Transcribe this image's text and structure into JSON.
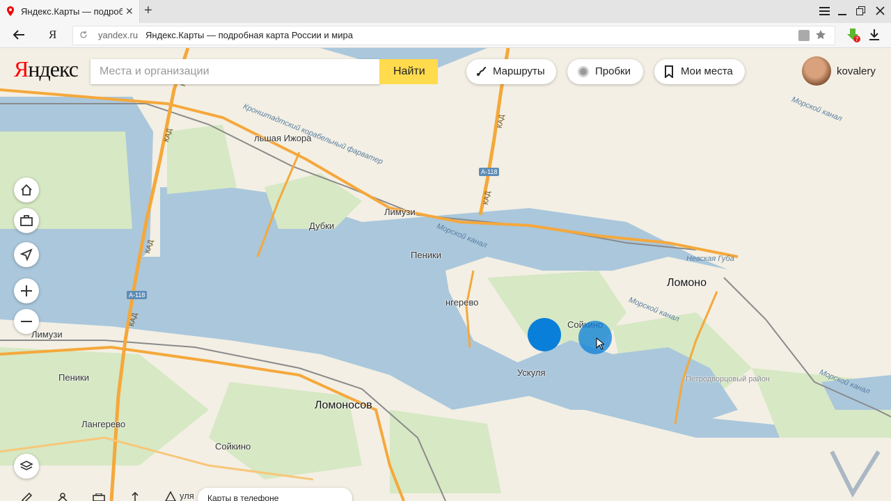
{
  "browser": {
    "tab_title": "Яндекс.Карты — подробная карта России и мира",
    "tab_close": "✕",
    "new_tab": "+",
    "yandex_button": "Я",
    "url_host": "yandex.ru",
    "url_page_title": "Яндекс.Карты — подробная карта России и мира"
  },
  "header": {
    "logo_first": "Я",
    "logo_rest": "ндекс",
    "search_placeholder": "Места и организации",
    "search_button": "Найти",
    "routes_label": "Маршруты",
    "traffic_label": "Пробки",
    "my_places_label": "Мои места",
    "username": "kovalery"
  },
  "map_labels": {
    "kronstadt_channel": "Кронштадтский корабельный фарватер",
    "bolshaya_izhora": "льшая Ижора",
    "limuzi_top": "Лимузи",
    "dubki": "Дубки",
    "peniki_top": "Пеники",
    "morskoy_kanal_1": "Морской канал",
    "morskoy_kanal_2": "Морской канал",
    "morskoy_kanal_3": "Морской канал",
    "morskoy_kanal_4": "Морской канал",
    "nevskaya_guba": "Невская Губа",
    "lomono_right": "Ломоно",
    "langerevo_top": "нгерево",
    "soykino_top": "Сойкино",
    "uskulya": "Ускуля",
    "petrodvortsovy": "Петродворцовый район",
    "limuzi_left": "Лимузи",
    "peniki_left": "Пеники",
    "lomonosov": "Ломоносов",
    "langerevo_left": "Лангерево",
    "soykino_left": "Сойкино",
    "kulya": "уля",
    "a118_1": "A-118",
    "a118_2": "A-118",
    "kad_1": "КАД",
    "kad_2": "КАД",
    "kad_3": "КАД",
    "kad_4": "КАД",
    "kad_5": "КАД",
    "kad_6": "КАД"
  },
  "footer": {
    "phone_promo": "Карты в телефоне"
  },
  "colors": {
    "water": "#aac7dc",
    "land": "#f3efe4",
    "green": "#d7e8c4",
    "road": "#f5a83b",
    "search_button": "#ffdb4d",
    "logo_red": "#ff0000",
    "point": "#0a7fd9"
  }
}
